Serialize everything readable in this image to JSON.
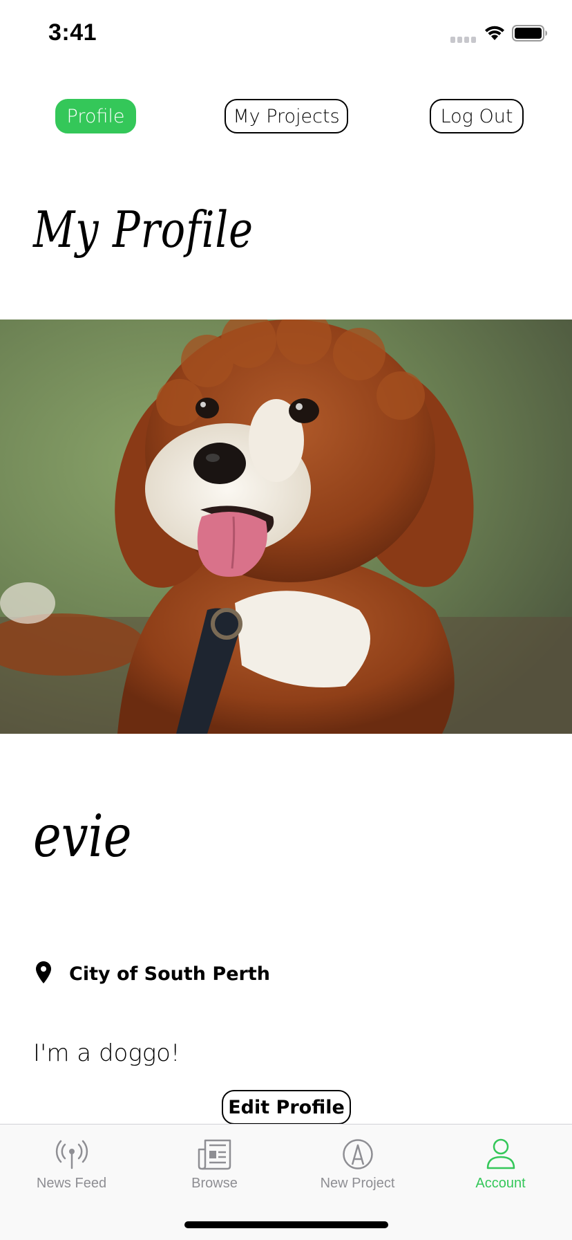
{
  "status_bar": {
    "time": "3:41"
  },
  "top_nav": {
    "profile": "Profile",
    "my_projects": "My Projects",
    "log_out": "Log Out",
    "active": "Profile"
  },
  "page_title": "My Profile",
  "profile": {
    "photo": "dog-photo",
    "username": "evie",
    "location": "City of South Perth",
    "bio": "I'm a doggo!"
  },
  "actions": {
    "edit_profile": "Edit Profile"
  },
  "tab_bar": {
    "tabs": [
      {
        "label": "News Feed",
        "icon": "antenna-icon"
      },
      {
        "label": "Browse",
        "icon": "newspaper-icon"
      },
      {
        "label": "New Project",
        "icon": "compass-pen-icon"
      },
      {
        "label": "Account",
        "icon": "person-icon"
      }
    ],
    "active": "Account"
  },
  "colors": {
    "accent": "#34c759",
    "inactive_tab": "#8e8e93"
  }
}
